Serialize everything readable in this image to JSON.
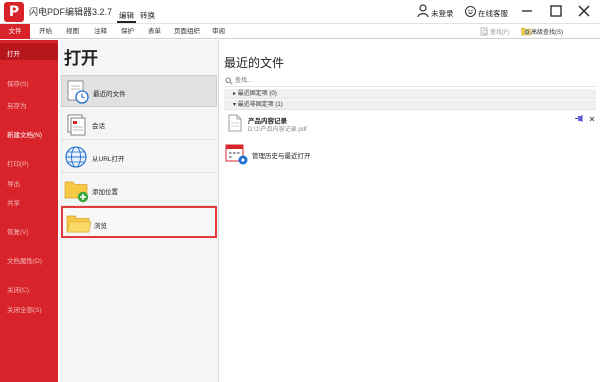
{
  "app": {
    "logo_char": "P",
    "title": "闪电PDF编辑器3.2.7",
    "mode_tabs": [
      "编辑",
      "转换"
    ],
    "login_label": "未登录",
    "service_label": "在线客服"
  },
  "ribbon": {
    "tabs": [
      "文件",
      "开始",
      "视图",
      "注释",
      "保护",
      "表单",
      "页面组织",
      "审阅"
    ],
    "search_label": "查找(F)",
    "advanced_search_label": "高级查找(S)"
  },
  "sidebar": {
    "items": [
      "打开",
      "保存(S)",
      "另存为",
      "新建文档(N)",
      "打印(P)",
      "导出",
      "共享",
      "恢复(V)",
      "文档属性(D)",
      "关闭(C)",
      "关闭全部(S)"
    ]
  },
  "open_panel": {
    "heading": "打开",
    "items": [
      "最近的文件",
      "会话",
      "从URL打开",
      "添加位置",
      "浏览"
    ]
  },
  "recent": {
    "heading": "最近的文件",
    "search_placeholder": "查找...",
    "groups": [
      "最近固定项 (0)",
      "最近非固定项 (1)"
    ],
    "file": {
      "name": "产品内容记录",
      "path": "D:\\1\\产品内容记录.pdf"
    },
    "manage_label": "管理历史与最近打开"
  },
  "colors": {
    "brand": "#d8232a",
    "highlight_border": "#e03a3a"
  }
}
